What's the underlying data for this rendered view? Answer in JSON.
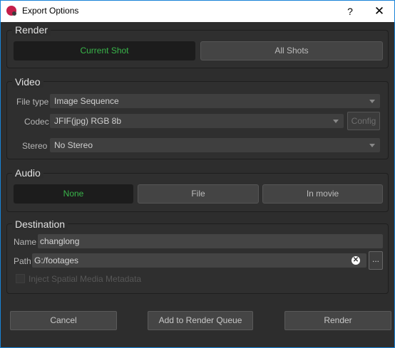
{
  "window": {
    "title": "Export Options",
    "help_label": "?",
    "close_label": "✕"
  },
  "render": {
    "title": "Render",
    "options": [
      {
        "label": "Current Shot",
        "selected": true
      },
      {
        "label": "All Shots",
        "selected": false
      }
    ]
  },
  "video": {
    "title": "Video",
    "file_type_label": "File type",
    "file_type_value": "Image Sequence",
    "codec_label": "Codec",
    "codec_value": "JFIF(jpg) RGB  8b",
    "config_label": "Config",
    "stereo_label": "Stereo",
    "stereo_value": "No Stereo"
  },
  "audio": {
    "title": "Audio",
    "options": [
      {
        "label": "None",
        "selected": true
      },
      {
        "label": "File",
        "selected": false
      },
      {
        "label": "In movie",
        "selected": false
      }
    ]
  },
  "destination": {
    "title": "Destination",
    "name_label": "Name",
    "name_value": "changlong",
    "path_label": "Path",
    "path_value": "G:/footages",
    "browse_label": "...",
    "clear_label": "✕",
    "spatial_label": "Inject Spatial Media Metadata",
    "spatial_checked": false
  },
  "footer": {
    "cancel_label": "Cancel",
    "queue_label": "Add to Render Queue",
    "render_label": "Render"
  },
  "colors": {
    "accent_green": "#39b54a",
    "window_border": "#1883d7",
    "app_icon": "#c41e4a"
  }
}
